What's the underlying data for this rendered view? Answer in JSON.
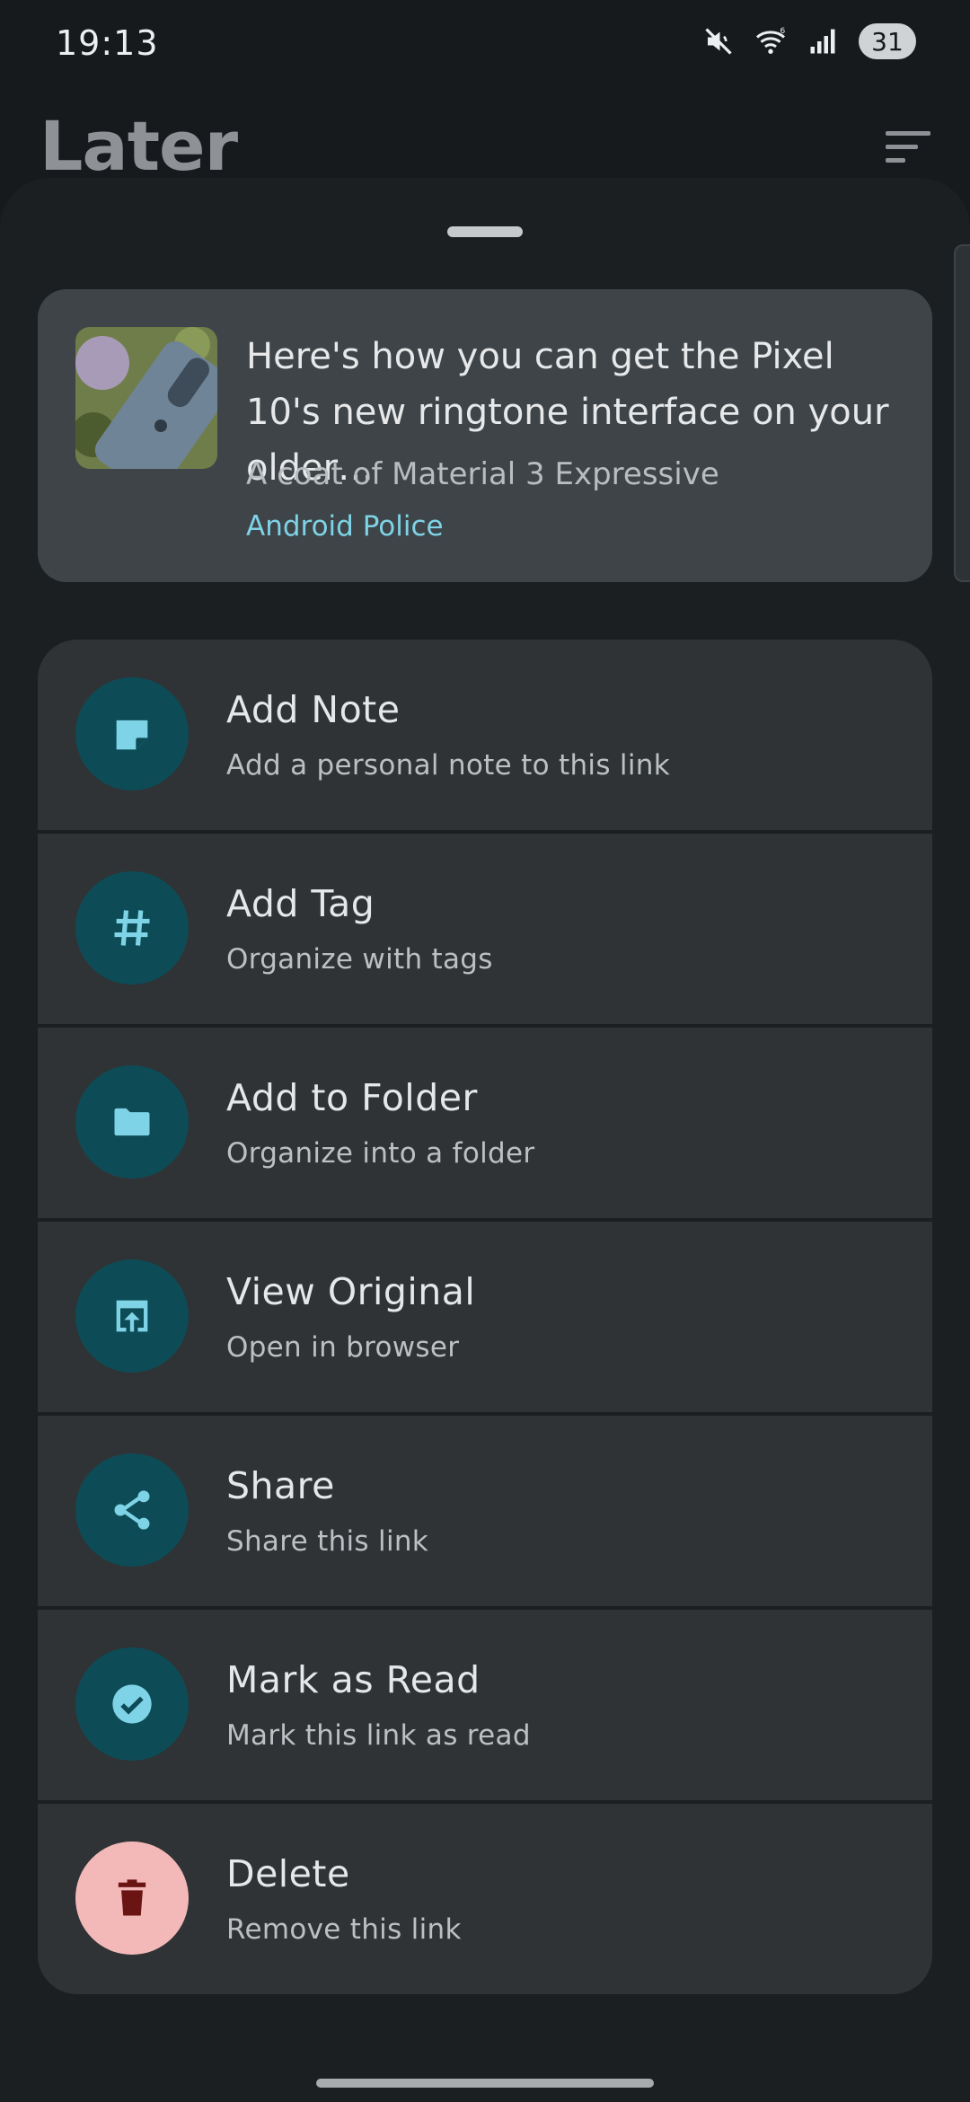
{
  "status_bar": {
    "time": "19:13",
    "icons": [
      "mute-icon",
      "wifi-icon",
      "signal-icon"
    ],
    "battery": "31"
  },
  "app_bar": {
    "title": "Later",
    "sort_icon": "sort-icon"
  },
  "preview": {
    "title": "Here's how you can get the Pixel 10's new ringtone interface on your older…",
    "subtitle": "A coat of Material 3 Expressive",
    "source": "Android Police",
    "source_color": "#7fd3e6"
  },
  "actions": [
    {
      "title": "Add Note",
      "description": "Add a personal note to this link",
      "icon": "note-icon"
    },
    {
      "title": "Add Tag",
      "description": "Organize with tags",
      "icon": "hashtag-icon"
    },
    {
      "title": "Add to Folder",
      "description": "Organize into a folder",
      "icon": "folder-icon"
    },
    {
      "title": "View Original",
      "description": "Open in browser",
      "icon": "open-in-browser-icon"
    },
    {
      "title": "Share",
      "description": "Share this link",
      "icon": "share-icon"
    },
    {
      "title": "Mark as Read",
      "description": "Mark this link as read",
      "icon": "check-circle-icon"
    },
    {
      "title": "Delete",
      "description": "Remove this link",
      "icon": "trash-icon"
    }
  ],
  "colors": {
    "accent_circle": "#0d4c56",
    "accent_icon": "#7fd3e6",
    "danger_circle": "#f3b9b8",
    "danger_icon": "#6a1414"
  }
}
